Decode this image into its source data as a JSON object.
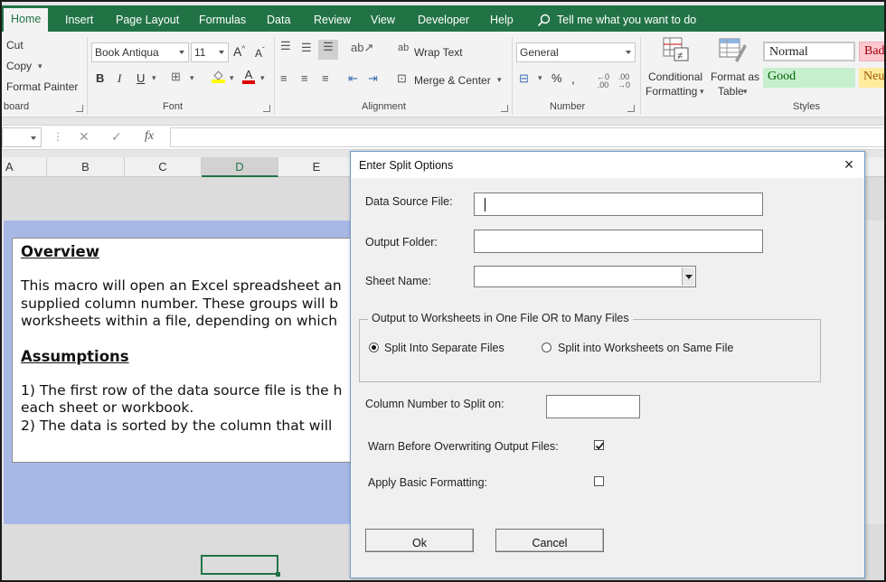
{
  "ribbon_tabs": [
    "Home",
    "Insert",
    "Page Layout",
    "Formulas",
    "Data",
    "Review",
    "View",
    "Developer",
    "Help"
  ],
  "tell_me": "Tell me what you want to do",
  "clipboard": {
    "cut": "Cut",
    "copy": "Copy",
    "format_painter": "Format Painter",
    "group": "board"
  },
  "font": {
    "name": "Book Antiqua",
    "size": "11",
    "bold": "B",
    "italic": "I",
    "underline": "U",
    "group": "Font"
  },
  "alignment": {
    "wrap_text": "Wrap Text",
    "merge_center": "Merge & Center",
    "group": "Alignment"
  },
  "number": {
    "format": "General",
    "percent": "%",
    "group": "Number"
  },
  "styles": {
    "conditional_1": "Conditional",
    "conditional_2": "Formatting",
    "format_as_1": "Format as",
    "format_as_2": "Table",
    "normal": "Normal",
    "bad": "Bad",
    "good": "Good",
    "neutral": "Neu",
    "group": "Styles"
  },
  "formula_bar": {
    "fx": "fx"
  },
  "columns": [
    "A",
    "B",
    "C",
    "D",
    "E"
  ],
  "textbox": {
    "overview_heading": "Overview",
    "line1": "This macro will open an Excel spreadsheet an",
    "line2": "supplied column number. These groups will b",
    "line3": "worksheets within a file, depending on which",
    "assumptions_heading": "Assumptions",
    "line4": "1) The first row of the data source file is the h",
    "line5": "each sheet or workbook.",
    "line6": "2) The data is sorted by the column that will"
  },
  "dialog": {
    "title": "Enter Split Options",
    "data_source_label": "Data Source File:",
    "data_source_value": "",
    "output_folder_label": "Output Folder:",
    "output_folder_value": "",
    "sheet_name_label": "Sheet Name:",
    "sheet_name_value": "",
    "frame_legend": "Output to Worksheets in One File OR to Many Files",
    "radio_separate": "Split Into Separate Files",
    "radio_same": "Split into Worksheets on Same File",
    "radio_selected": "separate",
    "column_label": "Column Number to Split on:",
    "column_value": "",
    "warn_label": "Warn Before Overwriting Output Files:",
    "warn_checked": true,
    "formatting_label": "Apply Basic Formatting:",
    "formatting_checked": false,
    "ok": "Ok",
    "cancel": "Cancel"
  },
  "colors": {
    "excel_green": "#217346",
    "panel_blue": "#a8b8e6",
    "good_fill": "#c6efce",
    "bad_fill": "#ffc7ce",
    "neutral_fill": "#ffeb9c"
  }
}
